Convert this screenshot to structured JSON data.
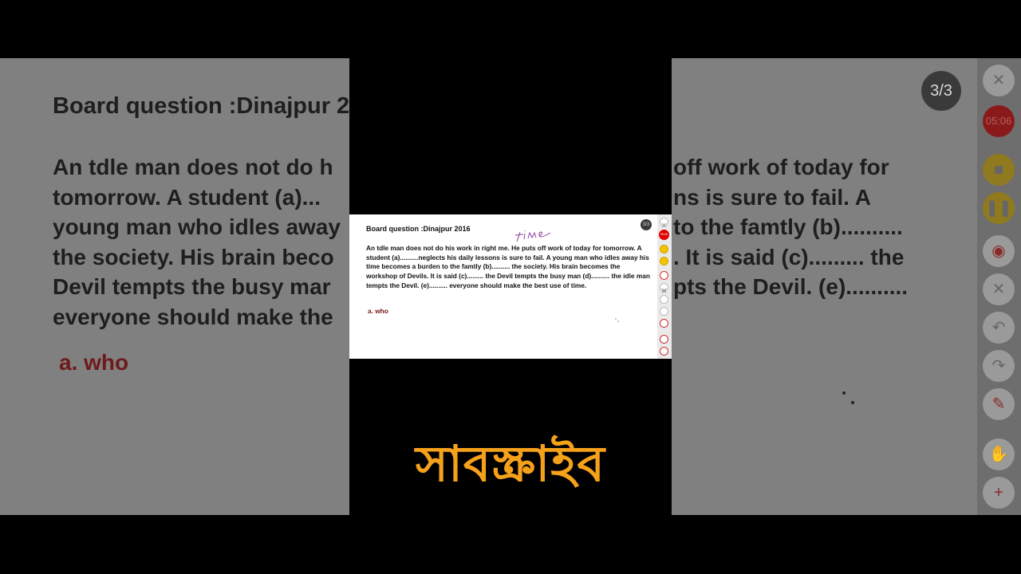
{
  "slide": {
    "title": "Board question :Dinajpur 2016",
    "body": "An tdle man does not do his work in right me. He puts off work of today for tomorrow. A student (a)..........neglects his daily lessons is sure to fail. A young man who idles away his time becomes a burden to the famtly (b).......... the society. His brain becomes the workshop of Devils. It is said (c)......... the Devil tempts the busy man (d).......... the idle man tempts the Devil. (e).......... everyone should make the best use of time.",
    "answer": "a. who",
    "page_indicator": "3/3",
    "handwritten_annotation": "time"
  },
  "background": {
    "title": "Board question :Dinajpur 2",
    "lines": [
      "An tdle man does not do h",
      "tomorrow. A student (a)...",
      "young man who idles away",
      "the society. His brain beco",
      "Devil tempts the busy mar",
      "everyone should make the"
    ],
    "lines_right": [
      "off work of today for",
      "ns is sure to fail. A",
      "to the famtly (b)..........",
      ". It is said (c)......... the",
      "pts the Devil. (e)..........",
      ""
    ],
    "answer": "a. who",
    "page_indicator": "3/3"
  },
  "toolbar": {
    "timer": "05:06",
    "tools": [
      "close-icon",
      "stop-record-icon",
      "pause-icon",
      "camera-icon",
      "clear-icon",
      "undo-icon",
      "redo-icon",
      "pen-icon",
      "hand-icon",
      "add-page-icon"
    ]
  },
  "subscribe_text": "সাবস্ক্রাইব",
  "colors": {
    "subscribe": "#f6a11a",
    "timer": "#e00000",
    "answer": "#7a1515"
  }
}
